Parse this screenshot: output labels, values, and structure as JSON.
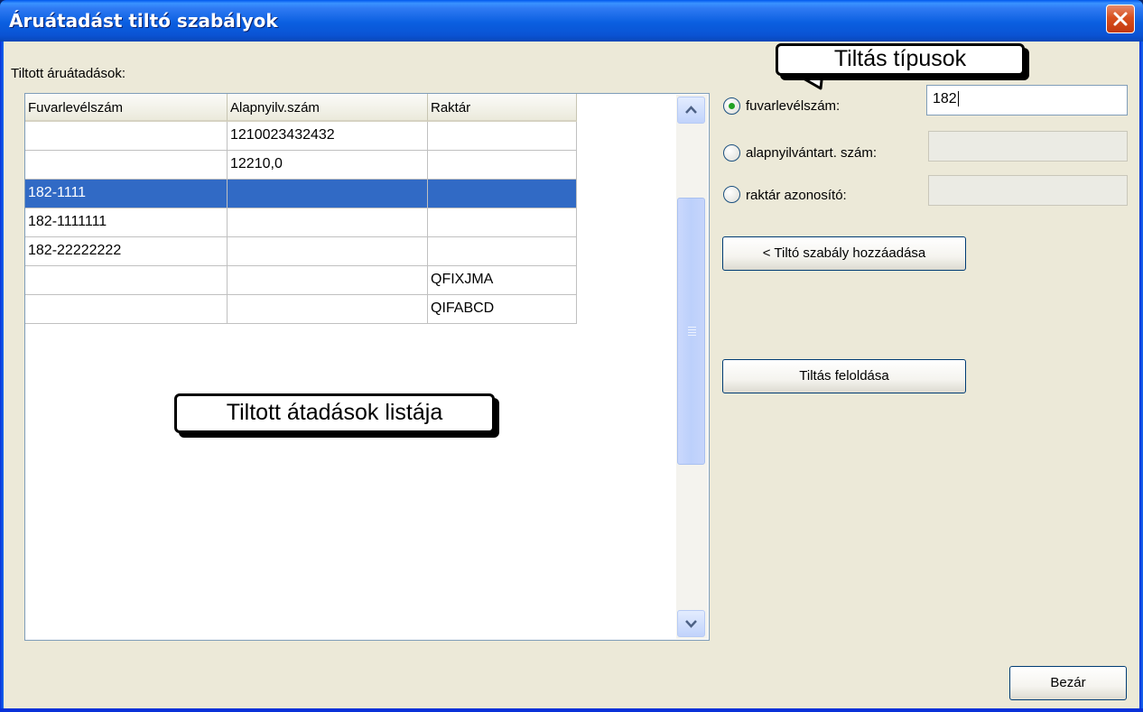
{
  "window": {
    "title": "Áruátadást tiltó szabályok"
  },
  "list": {
    "label": "Tiltott áruátadások:",
    "columns": [
      "Fuvarlevélszám",
      "Alapnyilv.szám",
      "Raktár"
    ],
    "rows": [
      [
        "",
        "1210023432432",
        ""
      ],
      [
        "",
        "12210,0",
        ""
      ],
      [
        "182-1111",
        "",
        ""
      ],
      [
        "182-1111111",
        "",
        ""
      ],
      [
        "182-22222222",
        "",
        ""
      ],
      [
        "",
        "",
        "QFIXJMA"
      ],
      [
        "",
        "",
        "QIFABCD"
      ]
    ],
    "selected_row": "182-1111"
  },
  "callouts": {
    "list": "Tiltott átadások listája",
    "types": "Tiltás típusok"
  },
  "options": {
    "fuvarlevel": {
      "label": "fuvarlevélszám:",
      "value": "182",
      "selected": true
    },
    "alapnyilv": {
      "label": "alapnyilvántart. szám:",
      "value": ""
    },
    "raktar": {
      "label": "raktár azonosító:",
      "value": ""
    }
  },
  "buttons": {
    "add": "< Tiltó szabály hozzáadása",
    "remove": "Tiltás feloldása",
    "close": "Bezár"
  },
  "icons": {
    "close": "close-x-icon",
    "scroll_up": "chevron-up-icon",
    "scroll_down": "chevron-down-icon"
  }
}
